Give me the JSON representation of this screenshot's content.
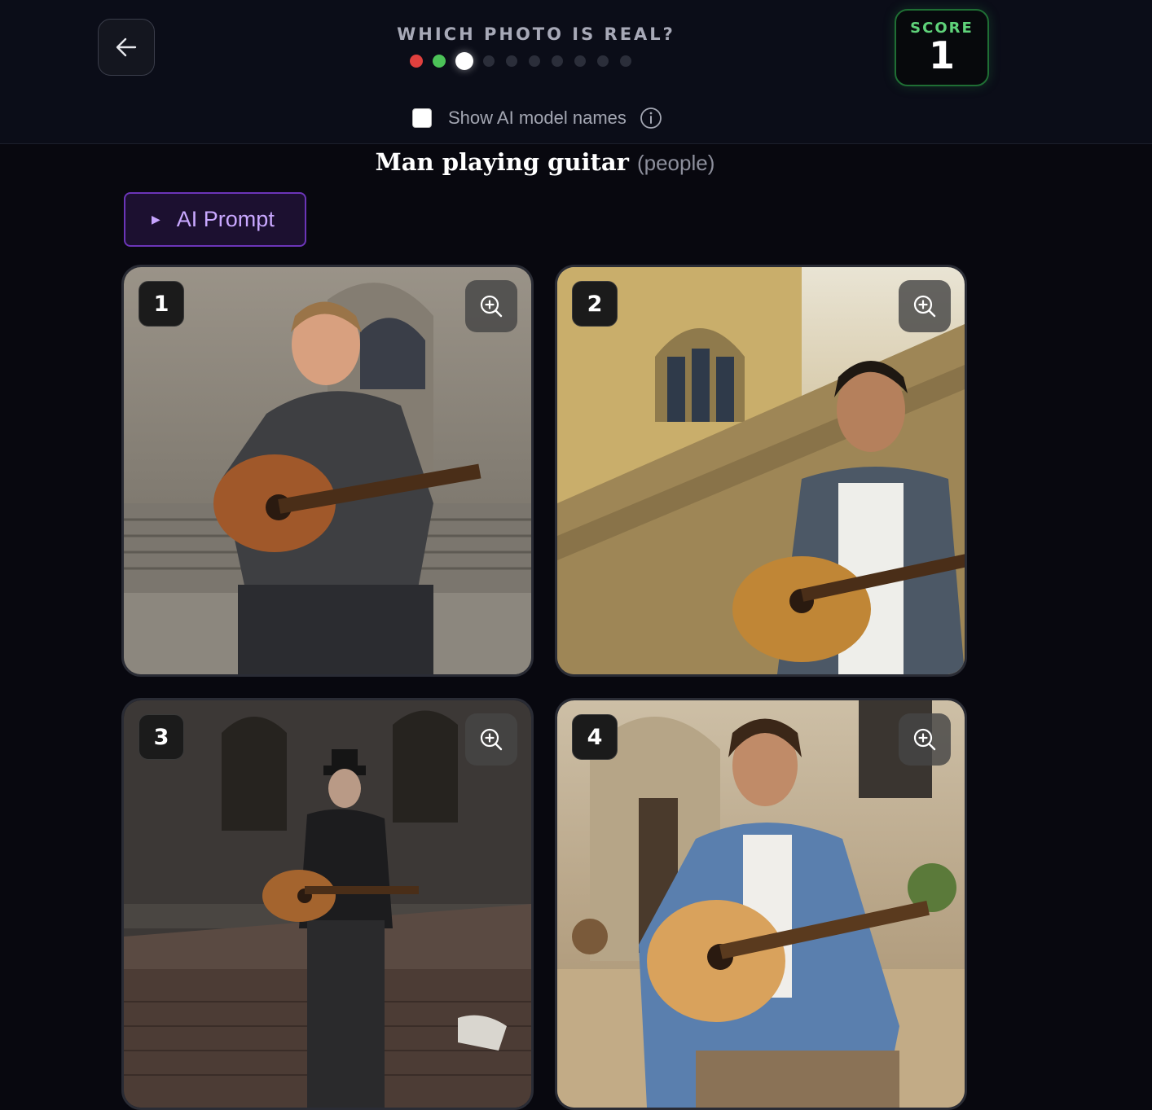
{
  "header": {
    "title": "WHICH PHOTO IS REAL?",
    "progress": [
      "wrong",
      "right",
      "current",
      "pending",
      "pending",
      "pending",
      "pending",
      "pending",
      "pending",
      "pending"
    ],
    "score_label": "SCORE",
    "score_value": "1",
    "toggle_label": "Show AI model names",
    "toggle_checked": false
  },
  "subject": {
    "title": "Man playing guitar",
    "category": "(people)"
  },
  "prompt_button": {
    "label": "AI Prompt"
  },
  "cards": [
    {
      "number": "1"
    },
    {
      "number": "2"
    },
    {
      "number": "3"
    },
    {
      "number": "4"
    }
  ],
  "colors": {
    "background": "#08080f",
    "header": "#0b0d18",
    "score_accent": "#5fd37a",
    "prompt_accent": "#c9a8ff",
    "wrong": "#e0403e",
    "right": "#4cc258"
  }
}
